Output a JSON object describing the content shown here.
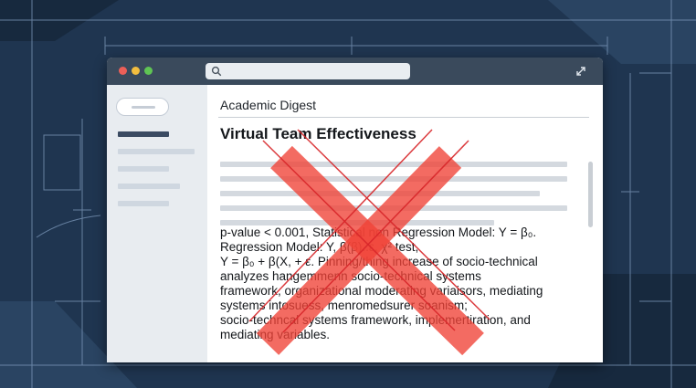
{
  "icons": {
    "search": "search-icon",
    "expand": "expand-icon",
    "overlay": "x-cross-icon"
  },
  "colors": {
    "background": "#1f3550",
    "titlebar": "#3a4a5c",
    "sidebar": "#e8ecf0",
    "x_overlay": "#ef4136",
    "traffic_red": "#ec5f58",
    "traffic_yellow": "#f2bd3f",
    "traffic_green": "#5fc454"
  },
  "article": {
    "publication": "Academic Digest",
    "title": "Virtual Team Effectiveness",
    "body": "p-value < 0.001, Statistical non Regression Model: Y = β₀.\nRegression Model: Y, β(β)..ε, χ² test,\nY = β₀ + β(X, + ε. Pinning/thing increase of socio-technical\nanalyzes hangemmenn socio-technical systems\nframework, organizational moderating variaisors, mediating\nsystems intosuess, menromedsurer soanism;\nsocio-techncal systems framework, implemertiration, and\nmediating variables."
  }
}
